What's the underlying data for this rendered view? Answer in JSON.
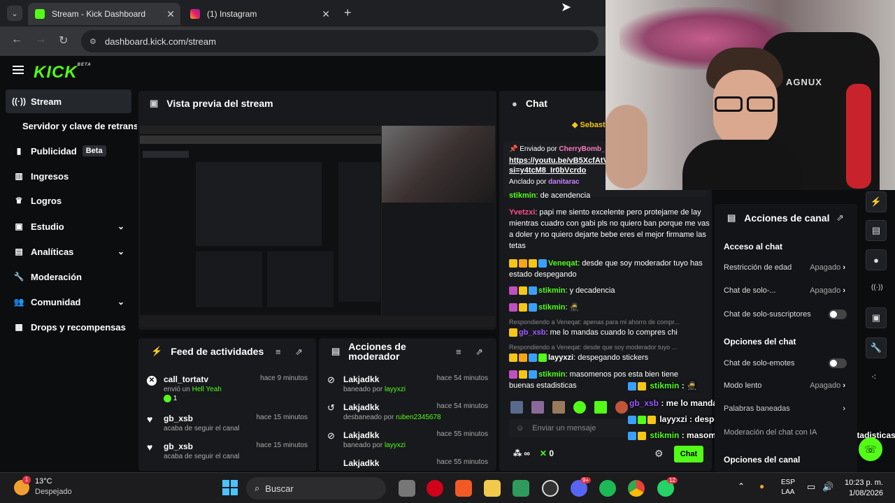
{
  "browser": {
    "tabs": [
      {
        "label": "Stream - Kick Dashboard",
        "close": "✕"
      },
      {
        "label": "(1) Instagram",
        "close": "✕"
      }
    ],
    "new_tab": "+",
    "url": "dashboard.kick.com/stream"
  },
  "kick": {
    "logo": "KICK",
    "beta": "BETA"
  },
  "sidebar": {
    "items": [
      {
        "label": "Stream",
        "icon": "broadcast-icon"
      },
      {
        "label": "Servidor y clave de retransmisión"
      },
      {
        "label": "Publicidad",
        "badge": "Beta",
        "icon": "megaphone-icon"
      },
      {
        "label": "Ingresos",
        "icon": "bars-icon"
      },
      {
        "label": "Logros",
        "icon": "trophy-icon"
      },
      {
        "label": "Estudio",
        "icon": "studio-icon"
      },
      {
        "label": "Analíticas",
        "icon": "chart-icon"
      },
      {
        "label": "Moderación",
        "icon": "wrench-icon"
      },
      {
        "label": "Comunidad",
        "icon": "people-icon"
      },
      {
        "label": "Drops y recompensas",
        "icon": "gift-icon"
      }
    ]
  },
  "preview": {
    "title": "Vista previa del stream"
  },
  "feed": {
    "title": "Feed de actividades",
    "items": [
      {
        "name": "call_tortatv",
        "sub": "envió un",
        "highlight": "Hell Yeah",
        "extra": "1",
        "time": "hace 9 minutos"
      },
      {
        "name": "gb_xsb",
        "sub": "acaba de seguir el canal",
        "time": "hace 15 minutos"
      },
      {
        "name": "gb_xsb",
        "sub": "acaba de seguir el canal",
        "time": "hace 15 minutos"
      }
    ]
  },
  "mod": {
    "title": "Acciones de moderador",
    "items": [
      {
        "name": "Lakjadkk",
        "sub": "baneado por",
        "by": "layyxzi",
        "time": "hace 54 minutos"
      },
      {
        "name": "Lakjadkk",
        "sub": "desbaneado por",
        "by": "ruben2345678",
        "time": "hace 54 minutos"
      },
      {
        "name": "Lakjadkk",
        "sub": "baneado por",
        "by": "layyxzi",
        "time": "hace 55 minutos"
      },
      {
        "name": "Lakjadkk",
        "sub": "",
        "by": "",
        "time": "hace 55 minutos"
      }
    ]
  },
  "chat": {
    "title": "Chat",
    "pinned_user": "Sebast",
    "pinned_by_label": "Enviado por",
    "pinned_by": "CherryBomb_3",
    "pinned_link": "https://youtu.be/vB5XcfAtV si=y4tcM8_Ir0bVcrdo",
    "anchored_label": "Anclado por",
    "anchored_by": "danitarac",
    "messages": [
      {
        "user": "stikmin",
        "text": ": de acendencia",
        "color": "#53fc18"
      },
      {
        "user": "Yvetzxi",
        "text": ": papi me siento excelente pero protejame de lay mientras cuadro con gabi pls no quiero ban porque me vas a doler y no quiero dejarte bebe eres el mejor firmame las tetas",
        "color": "#ff4d8d"
      },
      {
        "user": "Veneqat",
        "text": ": desde que soy moderador tuyo has estado despegando",
        "color": "#53fc18"
      },
      {
        "user": "stikmin",
        "text": ": y decadencia",
        "color": "#53fc18"
      },
      {
        "user": "stikmin",
        "text": ":",
        "color": "#53fc18"
      },
      {
        "reply": "Respondiendo a Veneqat: apenas para mi ahorro de compr..."
      },
      {
        "user": "gb_xsb",
        "text": ": me lo mandas cuando lo compres chi",
        "color": "#9b59ff"
      },
      {
        "reply": "Respondiendo a Veneqat: desde que soy moderador tuyo ..."
      },
      {
        "user": "layyxzi",
        "text": ": despegando stickers",
        "color": "#ffffff"
      },
      {
        "user": "stikmin",
        "text": ": masomenos pos esta bien tiene buenas estadisticas",
        "color": "#53fc18"
      }
    ],
    "input_placeholder": "Enviar un mensaje",
    "viewers": "∞",
    "points": "0",
    "send": "Chat"
  },
  "overlay_chat": [
    {
      "user": "stikmin",
      "text": " : 🥷"
    },
    {
      "user": "gb_xsb",
      "text": " : me lo mandas cuando lo compres chi"
    },
    {
      "user": "layyxzi",
      "text": " : despegando stickers"
    },
    {
      "user": "stikmin",
      "text": " : masomenos pos esta bien tiene buenas estadisticas"
    }
  ],
  "actions": {
    "title": "Acciones de canal",
    "s1": "Acceso al chat",
    "rows1": [
      {
        "label": "Restricción de edad",
        "value": "Apagado"
      },
      {
        "label": "Chat de solo-...",
        "value": "Apagado"
      },
      {
        "label": "Chat de solo-suscriptores"
      }
    ],
    "s2": "Opciones del chat",
    "rows2": [
      {
        "label": "Chat de solo-emotes"
      },
      {
        "label": "Modo lento",
        "value": "Apagado"
      },
      {
        "label": "Palabras baneadas"
      },
      {
        "label": "Moderación del chat con IA"
      }
    ],
    "s3": "Opciones del canal"
  },
  "taskbar": {
    "temp": "13°C",
    "weather": "Despejado",
    "search": "Buscar",
    "lang1": "ESP",
    "lang2": "LAA",
    "time": "10:23 p. m.",
    "date": "1/08/2026",
    "notif_badge": "1",
    "wa_badge": "12",
    "discord_badge": "9+"
  },
  "colors": {
    "kick_green": "#53fc18",
    "bg": "#0b0d0f",
    "panel": "#17191c"
  }
}
